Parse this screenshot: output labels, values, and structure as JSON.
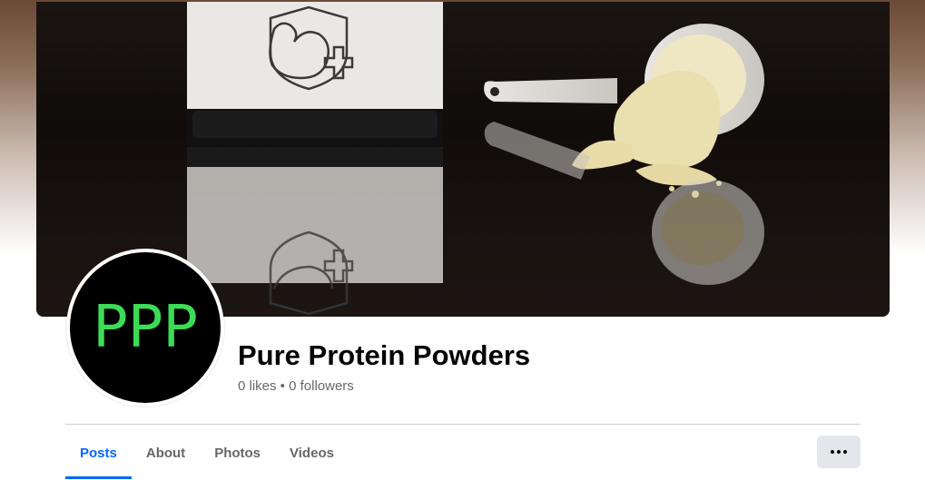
{
  "page": {
    "name": "Pure Protein Powders",
    "stats": "0 likes • 0 followers"
  },
  "avatar": {
    "text": "PPP",
    "text_color": "#3ddc57",
    "background": "#000000"
  },
  "tabs": [
    {
      "label": "Posts",
      "active": true
    },
    {
      "label": "About",
      "active": false
    },
    {
      "label": "Photos",
      "active": false
    },
    {
      "label": "Videos",
      "active": false
    }
  ],
  "more_button": {
    "icon": "more-horizontal-icon"
  },
  "cover_photo": {
    "subject": "protein container with bicep-plus logo and measuring scoop of powder"
  },
  "colors": {
    "accent": "#0866ff",
    "secondary_text": "#65676b",
    "button_bg": "#e4e6eb"
  }
}
